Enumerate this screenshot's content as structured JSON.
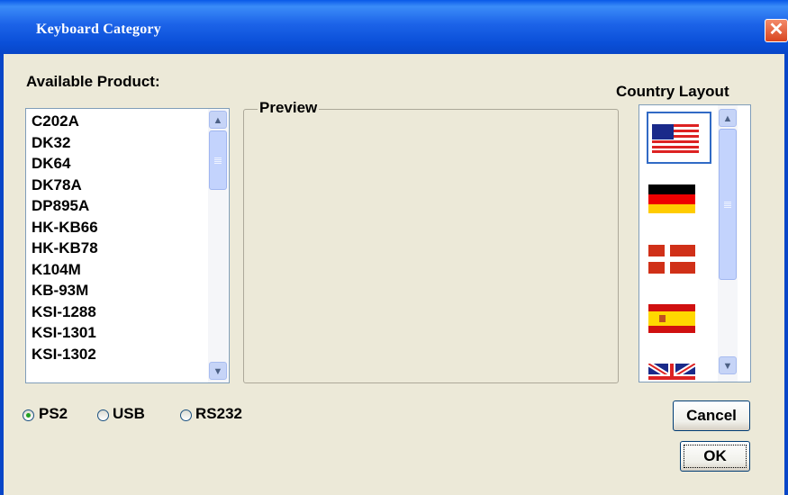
{
  "window": {
    "title": "Keyboard Category",
    "close_glyph": "✕"
  },
  "labels": {
    "available_product": "Available Product:",
    "preview": "Preview",
    "country_layout": "Country Layout"
  },
  "products": [
    "C202A",
    "DK32",
    "DK64",
    "DK78A",
    "DP895A",
    "HK-KB66",
    "HK-KB78",
    "K104M",
    "KB-93M",
    "KSI-1288",
    "KSI-1301",
    "KSI-1302"
  ],
  "flags": [
    {
      "name": "us-flag-icon",
      "selected": true
    },
    {
      "name": "germany-flag-icon",
      "selected": false
    },
    {
      "name": "denmark-flag-icon",
      "selected": false
    },
    {
      "name": "spain-flag-icon",
      "selected": false
    },
    {
      "name": "uk-flag-icon",
      "selected": false
    }
  ],
  "interfaces": [
    {
      "label": "PS2",
      "checked": true
    },
    {
      "label": "USB",
      "checked": false
    },
    {
      "label": "RS232",
      "checked": false
    }
  ],
  "buttons": {
    "cancel": "Cancel",
    "ok": "OK"
  },
  "scroll_arrows": {
    "up": "▲",
    "down": "▼"
  },
  "colors": {
    "titlebar": "#0a4fd8",
    "dialog_bg": "#ece9d8",
    "selection_border": "#316ac5"
  }
}
